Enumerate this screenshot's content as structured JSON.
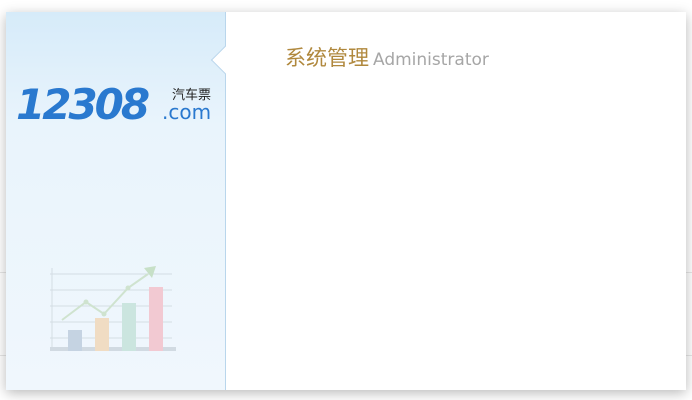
{
  "sidebar": {
    "logo": {
      "number": "12308",
      "chinese": "汽车票",
      "domain": ".com",
      "brand_color": "#2a79cf"
    },
    "illustration": "growth-bar-chart-icon"
  },
  "main": {
    "title_cn": "系统管理",
    "title_en": "Administrator",
    "title_cn_color": "#b0883d",
    "title_en_color": "#a6a6a6"
  }
}
